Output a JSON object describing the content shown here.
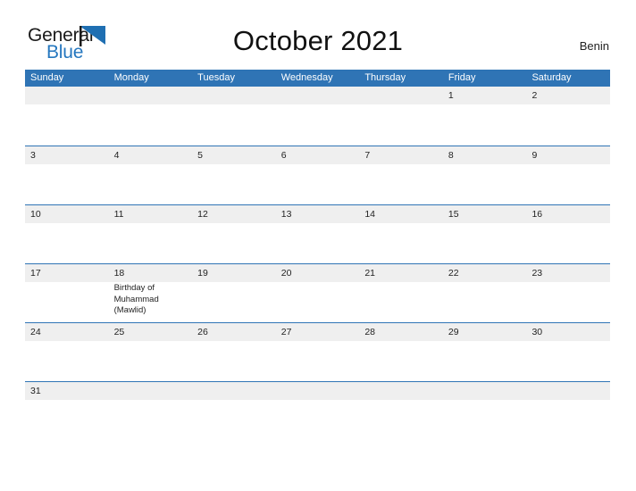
{
  "brand": {
    "word_one": "General",
    "word_two": "Blue",
    "flag_icon": "blue-triangle-flag-icon",
    "color_primary": "#2577bf",
    "color_text": "#1a1a1a"
  },
  "header": {
    "title": "October 2021",
    "locale": "Benin"
  },
  "theme": {
    "header_blue": "#2f74b5",
    "band_gray": "#efefef",
    "rule_blue": "#2f74b5",
    "text_dark": "#1f1f1f"
  },
  "calendar": {
    "weekdays": [
      "Sunday",
      "Monday",
      "Tuesday",
      "Wednesday",
      "Thursday",
      "Friday",
      "Saturday"
    ],
    "weeks": [
      {
        "days": [
          {
            "number": "",
            "events": []
          },
          {
            "number": "",
            "events": []
          },
          {
            "number": "",
            "events": []
          },
          {
            "number": "",
            "events": []
          },
          {
            "number": "",
            "events": []
          },
          {
            "number": "1",
            "events": []
          },
          {
            "number": "2",
            "events": []
          }
        ]
      },
      {
        "days": [
          {
            "number": "3",
            "events": []
          },
          {
            "number": "4",
            "events": []
          },
          {
            "number": "5",
            "events": []
          },
          {
            "number": "6",
            "events": []
          },
          {
            "number": "7",
            "events": []
          },
          {
            "number": "8",
            "events": []
          },
          {
            "number": "9",
            "events": []
          }
        ]
      },
      {
        "days": [
          {
            "number": "10",
            "events": []
          },
          {
            "number": "11",
            "events": []
          },
          {
            "number": "12",
            "events": []
          },
          {
            "number": "13",
            "events": []
          },
          {
            "number": "14",
            "events": []
          },
          {
            "number": "15",
            "events": []
          },
          {
            "number": "16",
            "events": []
          }
        ]
      },
      {
        "days": [
          {
            "number": "17",
            "events": []
          },
          {
            "number": "18",
            "events": [
              "Birthday of",
              "Muhammad",
              "(Mawlid)"
            ]
          },
          {
            "number": "19",
            "events": []
          },
          {
            "number": "20",
            "events": []
          },
          {
            "number": "21",
            "events": []
          },
          {
            "number": "22",
            "events": []
          },
          {
            "number": "23",
            "events": []
          }
        ]
      },
      {
        "days": [
          {
            "number": "24",
            "events": []
          },
          {
            "number": "25",
            "events": []
          },
          {
            "number": "26",
            "events": []
          },
          {
            "number": "27",
            "events": []
          },
          {
            "number": "28",
            "events": []
          },
          {
            "number": "29",
            "events": []
          },
          {
            "number": "30",
            "events": []
          }
        ]
      },
      {
        "short": true,
        "days": [
          {
            "number": "31",
            "events": []
          },
          {
            "number": "",
            "events": []
          },
          {
            "number": "",
            "events": []
          },
          {
            "number": "",
            "events": []
          },
          {
            "number": "",
            "events": []
          },
          {
            "number": "",
            "events": []
          },
          {
            "number": "",
            "events": []
          }
        ]
      }
    ]
  }
}
